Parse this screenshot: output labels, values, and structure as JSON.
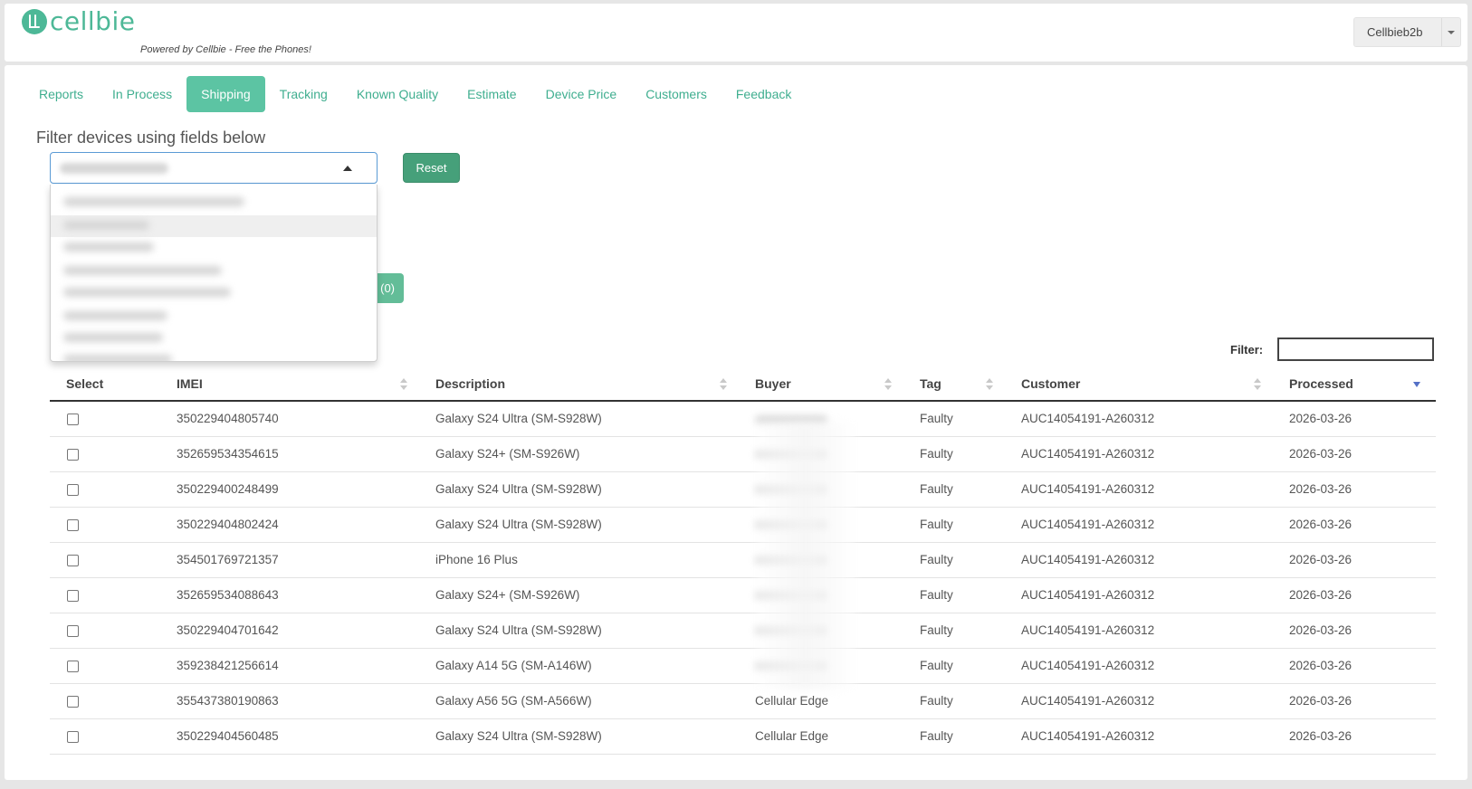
{
  "header": {
    "brand": "cellbie",
    "tagline": "Powered by Cellbie - Free the Phones!",
    "user_label": "Cellbieb2b",
    "accent_color": "#4db897"
  },
  "tabs": [
    {
      "label": "Reports",
      "active": false
    },
    {
      "label": "In Process",
      "active": false
    },
    {
      "label": "Shipping",
      "active": true
    },
    {
      "label": "Tracking",
      "active": false
    },
    {
      "label": "Known Quality",
      "active": false
    },
    {
      "label": "Estimate",
      "active": false
    },
    {
      "label": "Device Price",
      "active": false
    },
    {
      "label": "Customers",
      "active": false
    },
    {
      "label": "Feedback",
      "active": false
    }
  ],
  "filter": {
    "title": "Filter devices using fields below",
    "reset_label": "Reset",
    "partial_button_label": "(0)",
    "table_filter_label": "Filter:",
    "table_filter_value": ""
  },
  "table": {
    "columns": [
      "Select",
      "IMEI",
      "Description",
      "Buyer",
      "Tag",
      "Customer",
      "Processed"
    ],
    "rows": [
      {
        "imei": "350229404805740",
        "description": "Galaxy S24 Ultra (SM-S928W)",
        "buyer": "",
        "tag": "Faulty",
        "customer": "AUC14054191-A260312",
        "processed": "2026-03-26"
      },
      {
        "imei": "352659534354615",
        "description": "Galaxy S24+ (SM-S926W)",
        "buyer": "",
        "tag": "Faulty",
        "customer": "AUC14054191-A260312",
        "processed": "2026-03-26"
      },
      {
        "imei": "350229400248499",
        "description": "Galaxy S24 Ultra (SM-S928W)",
        "buyer": "",
        "tag": "Faulty",
        "customer": "AUC14054191-A260312",
        "processed": "2026-03-26"
      },
      {
        "imei": "350229404802424",
        "description": "Galaxy S24 Ultra (SM-S928W)",
        "buyer": "",
        "tag": "Faulty",
        "customer": "AUC14054191-A260312",
        "processed": "2026-03-26"
      },
      {
        "imei": "354501769721357",
        "description": "iPhone 16 Plus",
        "buyer": "",
        "tag": "Faulty",
        "customer": "AUC14054191-A260312",
        "processed": "2026-03-26"
      },
      {
        "imei": "352659534088643",
        "description": "Galaxy S24+ (SM-S926W)",
        "buyer": "",
        "tag": "Faulty",
        "customer": "AUC14054191-A260312",
        "processed": "2026-03-26"
      },
      {
        "imei": "350229404701642",
        "description": "Galaxy S24 Ultra (SM-S928W)",
        "buyer": "",
        "tag": "Faulty",
        "customer": "AUC14054191-A260312",
        "processed": "2026-03-26"
      },
      {
        "imei": "359238421256614",
        "description": "Galaxy A14 5G (SM-A146W)",
        "buyer": "",
        "tag": "Faulty",
        "customer": "AUC14054191-A260312",
        "processed": "2026-03-26"
      },
      {
        "imei": "355437380190863",
        "description": "Galaxy A56 5G (SM-A566W)",
        "buyer": "Cellular Edge",
        "tag": "Faulty",
        "customer": "AUC14054191-A260312",
        "processed": "2026-03-26"
      },
      {
        "imei": "350229404560485",
        "description": "Galaxy S24 Ultra (SM-S928W)",
        "buyer": "Cellular Edge",
        "tag": "Faulty",
        "customer": "AUC14054191-A260312",
        "processed": "2026-03-26"
      }
    ]
  }
}
